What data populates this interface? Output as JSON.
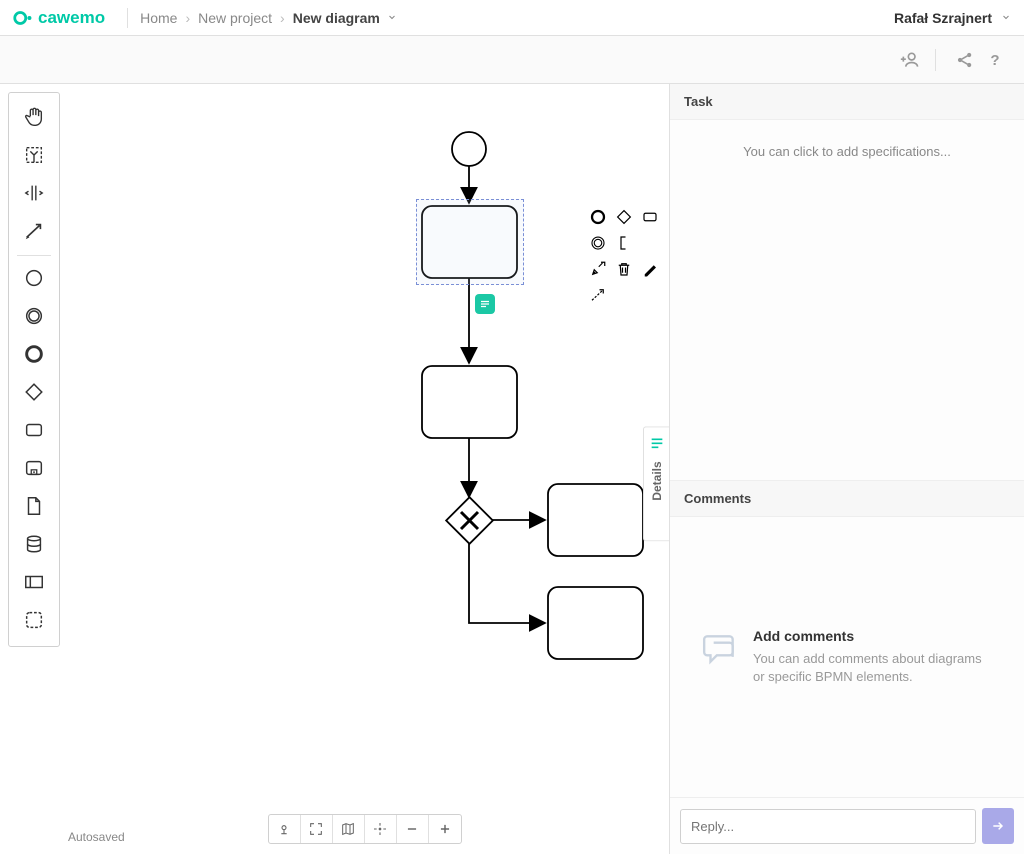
{
  "logo_text": "cawemo",
  "breadcrumb": {
    "home": "Home",
    "project": "New project",
    "current": "New diagram"
  },
  "user": "Rafał Szrajnert",
  "sidebar": {
    "task_header": "Task",
    "spec_placeholder": "You can click to add specifications...",
    "comments_header": "Comments",
    "comments_title": "Add comments",
    "comments_desc": "You can add comments about diagrams or specific BPMN elements.",
    "reply_placeholder": "Reply..."
  },
  "details_tab": "Details",
  "autosaved": "Autosaved"
}
